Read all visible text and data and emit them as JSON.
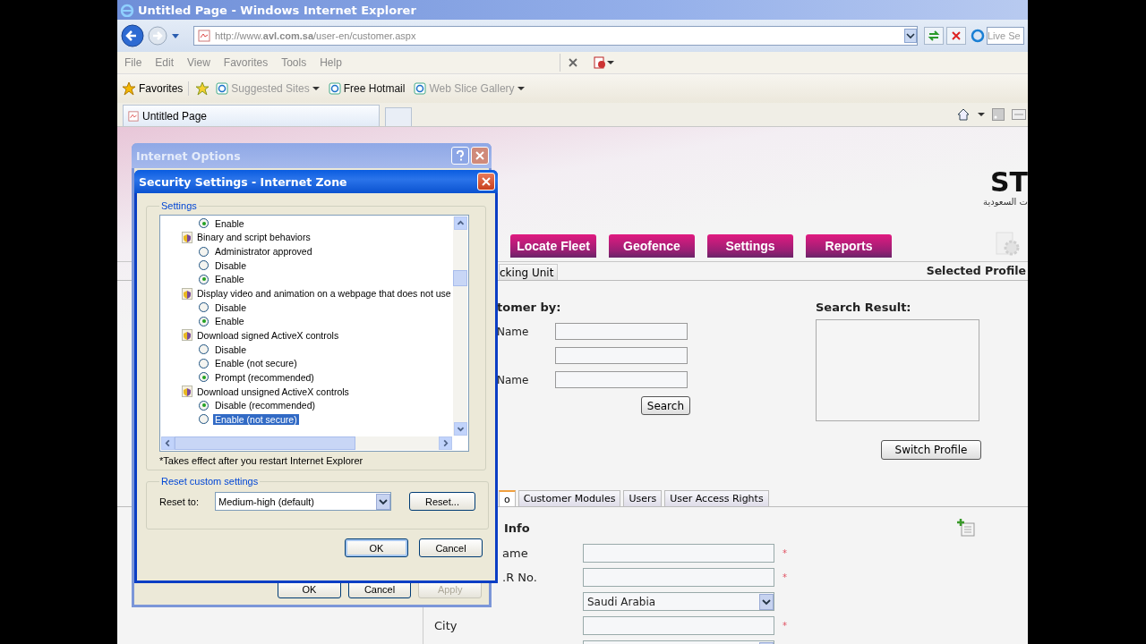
{
  "browser": {
    "title": "Untitled Page - Windows Internet Explorer",
    "url": "http://www.**avl.com.sa**/user-en/customer.aspx",
    "search": {
      "placeholder": "Live Se"
    },
    "menu": [
      "File",
      "Edit",
      "View",
      "Favorites",
      "Tools",
      "Help"
    ],
    "favorites": {
      "label": "Favorites",
      "links": [
        {
          "label": "Suggested Sites",
          "dropdown": true,
          "disabled": true
        },
        {
          "label": "Free Hotmail",
          "dropdown": false,
          "disabled": false
        },
        {
          "label": "Web Slice Gallery",
          "dropdown": true,
          "disabled": true
        }
      ]
    },
    "tabs": [
      {
        "label": "Untitled Page",
        "selected": true
      }
    ]
  },
  "page": {
    "logo": {
      "mark": "ST",
      "tagline": "ت السعودية"
    },
    "nav": [
      "Locate Fleet",
      "Geofence",
      "Settings",
      "Reports"
    ],
    "subtab": "cking Unit",
    "profile_label": "Selected Profile",
    "search": {
      "heading": "tomer by:",
      "fields": [
        {
          "kind": "labeled",
          "label": "Name"
        },
        {
          "kind": "plain"
        },
        {
          "kind": "labeled",
          "label": "Name"
        }
      ],
      "button": "Search"
    },
    "result": {
      "heading": "Search Result:",
      "button": "Switch Profile"
    },
    "tabs": [
      {
        "label": "o",
        "selected": true
      },
      {
        "label": "Customer Modules",
        "selected": false
      },
      {
        "label": "Users",
        "selected": false
      },
      {
        "label": "User Access Rights",
        "selected": false
      }
    ],
    "info": {
      "heading": "Info",
      "rows": [
        {
          "kind": "text",
          "label": "ame",
          "note": "*"
        },
        {
          "kind": "text",
          "label": ".R No.",
          "note": "*"
        },
        {
          "kind": "select",
          "value": "Saudi Arabia"
        },
        {
          "kind": "text",
          "label": "City",
          "note": "*"
        },
        {
          "kind": "select"
        }
      ]
    }
  },
  "dialogs": {
    "options": {
      "title": "Internet Options",
      "buttons": [
        {
          "label": "OK",
          "disabled": false
        },
        {
          "label": "Cancel",
          "disabled": false
        },
        {
          "label": "Apply",
          "disabled": true
        }
      ]
    },
    "security": {
      "title": "Security Settings - Internet Zone",
      "group": "Settings",
      "entries": [
        {
          "kind": "option",
          "label": "Enable",
          "checked": true,
          "focused": false
        },
        {
          "kind": "group",
          "label": "Binary and script behaviors",
          "children": [
            {
              "kind": "option",
              "label": "Administrator approved",
              "checked": false,
              "focused": false
            },
            {
              "kind": "option",
              "label": "Disable",
              "checked": false,
              "focused": false
            },
            {
              "kind": "option",
              "label": "Enable",
              "checked": true,
              "focused": false
            }
          ]
        },
        {
          "kind": "group",
          "label": "Display video and animation on a webpage that does not use",
          "children": [
            {
              "kind": "option",
              "label": "Disable",
              "checked": false,
              "focused": false
            },
            {
              "kind": "option",
              "label": "Enable",
              "checked": true,
              "focused": false
            }
          ]
        },
        {
          "kind": "group",
          "label": "Download signed ActiveX controls",
          "children": [
            {
              "kind": "option",
              "label": "Disable",
              "checked": false,
              "focused": false
            },
            {
              "kind": "option",
              "label": "Enable (not secure)",
              "checked": false,
              "focused": false
            },
            {
              "kind": "option",
              "label": "Prompt (recommended)",
              "checked": true,
              "focused": false
            }
          ]
        },
        {
          "kind": "group",
          "label": "Download unsigned ActiveX controls",
          "children": [
            {
              "kind": "option",
              "label": "Disable (recommended)",
              "checked": true,
              "focused": false
            },
            {
              "kind": "option",
              "label": "Enable (not secure)",
              "checked": false,
              "focused": true
            }
          ]
        }
      ],
      "footnote": "*Takes effect after you restart Internet Explorer",
      "reset": {
        "group": "Reset custom settings",
        "label": "Reset to:",
        "value": "Medium-high (default)",
        "button": "Reset..."
      },
      "buttons": [
        "OK",
        "Cancel"
      ]
    }
  }
}
